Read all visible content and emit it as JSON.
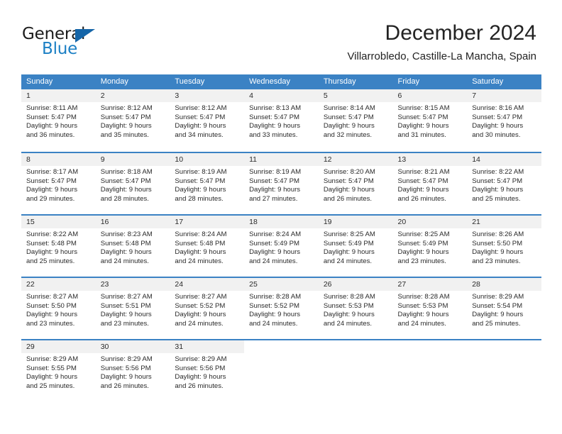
{
  "branding": {
    "name_part1": "General",
    "name_part2": "Blue",
    "triangle_icon": "blue-triangle-logo-icon"
  },
  "header": {
    "month_title": "December 2024",
    "location": "Villarrobledo, Castille-La Mancha, Spain"
  },
  "colors": {
    "header_blue": "#3b82c4",
    "logo_blue": "#1b7fc4",
    "daynum_band": "#f1f1f1",
    "text": "#2a2a2a"
  },
  "calendar": {
    "weekday_headers": [
      "Sunday",
      "Monday",
      "Tuesday",
      "Wednesday",
      "Thursday",
      "Friday",
      "Saturday"
    ],
    "weeks": [
      [
        {
          "day": "1",
          "sunrise": "Sunrise: 8:11 AM",
          "sunset": "Sunset: 5:47 PM",
          "daylight_line1": "Daylight: 9 hours",
          "daylight_line2": "and 36 minutes."
        },
        {
          "day": "2",
          "sunrise": "Sunrise: 8:12 AM",
          "sunset": "Sunset: 5:47 PM",
          "daylight_line1": "Daylight: 9 hours",
          "daylight_line2": "and 35 minutes."
        },
        {
          "day": "3",
          "sunrise": "Sunrise: 8:12 AM",
          "sunset": "Sunset: 5:47 PM",
          "daylight_line1": "Daylight: 9 hours",
          "daylight_line2": "and 34 minutes."
        },
        {
          "day": "4",
          "sunrise": "Sunrise: 8:13 AM",
          "sunset": "Sunset: 5:47 PM",
          "daylight_line1": "Daylight: 9 hours",
          "daylight_line2": "and 33 minutes."
        },
        {
          "day": "5",
          "sunrise": "Sunrise: 8:14 AM",
          "sunset": "Sunset: 5:47 PM",
          "daylight_line1": "Daylight: 9 hours",
          "daylight_line2": "and 32 minutes."
        },
        {
          "day": "6",
          "sunrise": "Sunrise: 8:15 AM",
          "sunset": "Sunset: 5:47 PM",
          "daylight_line1": "Daylight: 9 hours",
          "daylight_line2": "and 31 minutes."
        },
        {
          "day": "7",
          "sunrise": "Sunrise: 8:16 AM",
          "sunset": "Sunset: 5:47 PM",
          "daylight_line1": "Daylight: 9 hours",
          "daylight_line2": "and 30 minutes."
        }
      ],
      [
        {
          "day": "8",
          "sunrise": "Sunrise: 8:17 AM",
          "sunset": "Sunset: 5:47 PM",
          "daylight_line1": "Daylight: 9 hours",
          "daylight_line2": "and 29 minutes."
        },
        {
          "day": "9",
          "sunrise": "Sunrise: 8:18 AM",
          "sunset": "Sunset: 5:47 PM",
          "daylight_line1": "Daylight: 9 hours",
          "daylight_line2": "and 28 minutes."
        },
        {
          "day": "10",
          "sunrise": "Sunrise: 8:19 AM",
          "sunset": "Sunset: 5:47 PM",
          "daylight_line1": "Daylight: 9 hours",
          "daylight_line2": "and 28 minutes."
        },
        {
          "day": "11",
          "sunrise": "Sunrise: 8:19 AM",
          "sunset": "Sunset: 5:47 PM",
          "daylight_line1": "Daylight: 9 hours",
          "daylight_line2": "and 27 minutes."
        },
        {
          "day": "12",
          "sunrise": "Sunrise: 8:20 AM",
          "sunset": "Sunset: 5:47 PM",
          "daylight_line1": "Daylight: 9 hours",
          "daylight_line2": "and 26 minutes."
        },
        {
          "day": "13",
          "sunrise": "Sunrise: 8:21 AM",
          "sunset": "Sunset: 5:47 PM",
          "daylight_line1": "Daylight: 9 hours",
          "daylight_line2": "and 26 minutes."
        },
        {
          "day": "14",
          "sunrise": "Sunrise: 8:22 AM",
          "sunset": "Sunset: 5:47 PM",
          "daylight_line1": "Daylight: 9 hours",
          "daylight_line2": "and 25 minutes."
        }
      ],
      [
        {
          "day": "15",
          "sunrise": "Sunrise: 8:22 AM",
          "sunset": "Sunset: 5:48 PM",
          "daylight_line1": "Daylight: 9 hours",
          "daylight_line2": "and 25 minutes."
        },
        {
          "day": "16",
          "sunrise": "Sunrise: 8:23 AM",
          "sunset": "Sunset: 5:48 PM",
          "daylight_line1": "Daylight: 9 hours",
          "daylight_line2": "and 24 minutes."
        },
        {
          "day": "17",
          "sunrise": "Sunrise: 8:24 AM",
          "sunset": "Sunset: 5:48 PM",
          "daylight_line1": "Daylight: 9 hours",
          "daylight_line2": "and 24 minutes."
        },
        {
          "day": "18",
          "sunrise": "Sunrise: 8:24 AM",
          "sunset": "Sunset: 5:49 PM",
          "daylight_line1": "Daylight: 9 hours",
          "daylight_line2": "and 24 minutes."
        },
        {
          "day": "19",
          "sunrise": "Sunrise: 8:25 AM",
          "sunset": "Sunset: 5:49 PM",
          "daylight_line1": "Daylight: 9 hours",
          "daylight_line2": "and 24 minutes."
        },
        {
          "day": "20",
          "sunrise": "Sunrise: 8:25 AM",
          "sunset": "Sunset: 5:49 PM",
          "daylight_line1": "Daylight: 9 hours",
          "daylight_line2": "and 23 minutes."
        },
        {
          "day": "21",
          "sunrise": "Sunrise: 8:26 AM",
          "sunset": "Sunset: 5:50 PM",
          "daylight_line1": "Daylight: 9 hours",
          "daylight_line2": "and 23 minutes."
        }
      ],
      [
        {
          "day": "22",
          "sunrise": "Sunrise: 8:27 AM",
          "sunset": "Sunset: 5:50 PM",
          "daylight_line1": "Daylight: 9 hours",
          "daylight_line2": "and 23 minutes."
        },
        {
          "day": "23",
          "sunrise": "Sunrise: 8:27 AM",
          "sunset": "Sunset: 5:51 PM",
          "daylight_line1": "Daylight: 9 hours",
          "daylight_line2": "and 23 minutes."
        },
        {
          "day": "24",
          "sunrise": "Sunrise: 8:27 AM",
          "sunset": "Sunset: 5:52 PM",
          "daylight_line1": "Daylight: 9 hours",
          "daylight_line2": "and 24 minutes."
        },
        {
          "day": "25",
          "sunrise": "Sunrise: 8:28 AM",
          "sunset": "Sunset: 5:52 PM",
          "daylight_line1": "Daylight: 9 hours",
          "daylight_line2": "and 24 minutes."
        },
        {
          "day": "26",
          "sunrise": "Sunrise: 8:28 AM",
          "sunset": "Sunset: 5:53 PM",
          "daylight_line1": "Daylight: 9 hours",
          "daylight_line2": "and 24 minutes."
        },
        {
          "day": "27",
          "sunrise": "Sunrise: 8:28 AM",
          "sunset": "Sunset: 5:53 PM",
          "daylight_line1": "Daylight: 9 hours",
          "daylight_line2": "and 24 minutes."
        },
        {
          "day": "28",
          "sunrise": "Sunrise: 8:29 AM",
          "sunset": "Sunset: 5:54 PM",
          "daylight_line1": "Daylight: 9 hours",
          "daylight_line2": "and 25 minutes."
        }
      ],
      [
        {
          "day": "29",
          "sunrise": "Sunrise: 8:29 AM",
          "sunset": "Sunset: 5:55 PM",
          "daylight_line1": "Daylight: 9 hours",
          "daylight_line2": "and 25 minutes."
        },
        {
          "day": "30",
          "sunrise": "Sunrise: 8:29 AM",
          "sunset": "Sunset: 5:56 PM",
          "daylight_line1": "Daylight: 9 hours",
          "daylight_line2": "and 26 minutes."
        },
        {
          "day": "31",
          "sunrise": "Sunrise: 8:29 AM",
          "sunset": "Sunset: 5:56 PM",
          "daylight_line1": "Daylight: 9 hours",
          "daylight_line2": "and 26 minutes."
        },
        {
          "day": "",
          "sunrise": "",
          "sunset": "",
          "daylight_line1": "",
          "daylight_line2": ""
        },
        {
          "day": "",
          "sunrise": "",
          "sunset": "",
          "daylight_line1": "",
          "daylight_line2": ""
        },
        {
          "day": "",
          "sunrise": "",
          "sunset": "",
          "daylight_line1": "",
          "daylight_line2": ""
        },
        {
          "day": "",
          "sunrise": "",
          "sunset": "",
          "daylight_line1": "",
          "daylight_line2": ""
        }
      ]
    ]
  }
}
